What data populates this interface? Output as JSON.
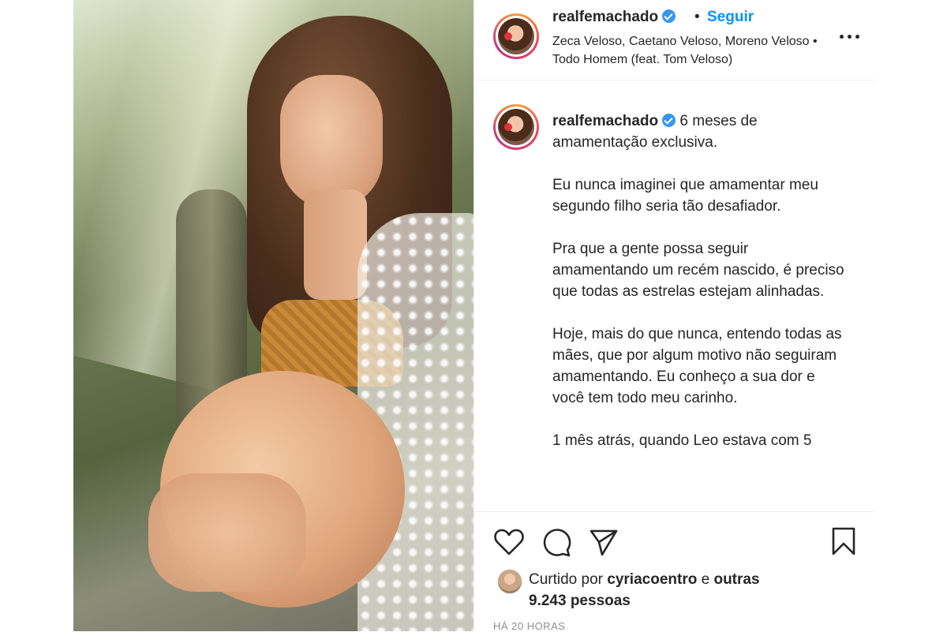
{
  "header": {
    "username": "realfemachado",
    "separator": "•",
    "follow_label": "Seguir",
    "music": "Zeca Veloso, Caetano Veloso, Moreno Veloso • Todo Homem (feat. Tom Veloso)"
  },
  "caption": {
    "username": "realfemachado",
    "paragraphs": [
      "6 meses de amamentação exclusiva.",
      "Eu nunca imaginei que amamentar meu segundo filho seria tão desafiador.",
      "Pra que a gente possa seguir amamentando um recém nascido, é preciso que todas as estrelas estejam alinhadas.",
      "Hoje, mais do que nunca, entendo todas as mães, que por algum motivo não seguiram amamentando. Eu conheço a sua dor e você tem todo meu carinho.",
      "1 mês atrás, quando Leo estava com 5"
    ]
  },
  "likes": {
    "prefix": "Curtido por",
    "liker": "cyriacoentro",
    "conjunction": "e",
    "others": "outras 9.243 pessoas"
  },
  "time_ago": "HÁ 20 HORAS",
  "icons": {
    "verified": "verified-badge-icon",
    "more": "more-options-icon",
    "like": "heart-icon",
    "comment": "comment-bubble-icon",
    "share": "paper-plane-icon",
    "save": "bookmark-icon"
  },
  "colors": {
    "link": "#0095f6",
    "verified": "#3897f0",
    "text": "#262626",
    "muted": "#8e8e8e"
  }
}
